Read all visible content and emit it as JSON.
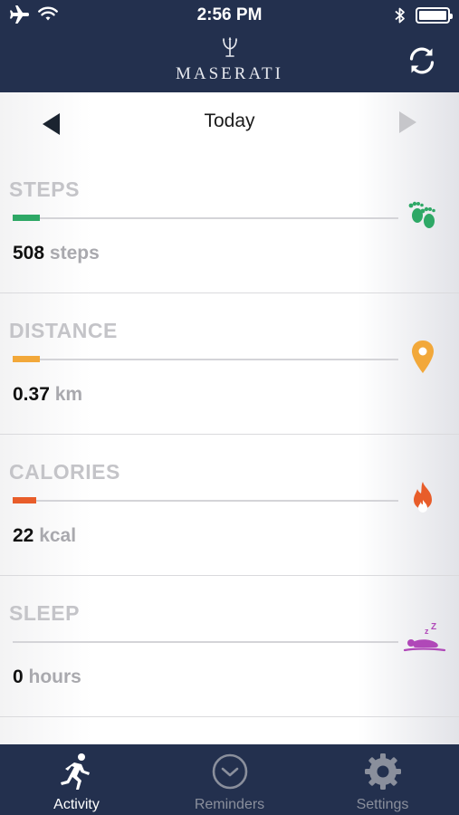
{
  "status": {
    "time": "2:56 PM"
  },
  "header": {
    "brand": "MASERATI"
  },
  "daynav": {
    "label": "Today"
  },
  "metrics": [
    {
      "title": "STEPS",
      "value": "508",
      "unit": "steps",
      "color": "#2ea866",
      "progress": 0.07,
      "icon": "footprints-icon"
    },
    {
      "title": "DISTANCE",
      "value": "0.37",
      "unit": "km",
      "color": "#f2a83a",
      "progress": 0.07,
      "icon": "location-pin-icon"
    },
    {
      "title": "CALORIES",
      "value": "22",
      "unit": "kcal",
      "color": "#e85d2a",
      "progress": 0.06,
      "icon": "flame-icon"
    },
    {
      "title": "SLEEP",
      "value": "0",
      "unit": "hours",
      "color": "#b048b8",
      "progress": 0,
      "icon": "sleeping-person-icon"
    }
  ],
  "tabs": [
    {
      "label": "Activity",
      "icon": "runner-icon",
      "active": true
    },
    {
      "label": "Reminders",
      "icon": "clock-icon",
      "active": false
    },
    {
      "label": "Settings",
      "icon": "gear-icon",
      "active": false
    }
  ],
  "colors": {
    "header_bg": "#23304e",
    "steps": "#2ea866",
    "distance": "#f2a83a",
    "calories": "#e85d2a",
    "sleep": "#b048b8"
  }
}
